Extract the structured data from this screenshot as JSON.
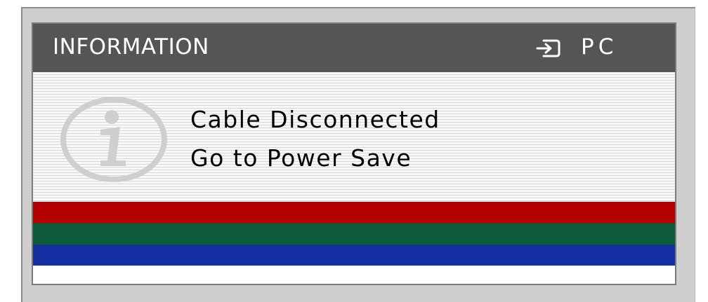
{
  "osd": {
    "title": "INFORMATION",
    "source_icon": "input-source-icon",
    "source_label": "PC",
    "info_icon": "info-icon",
    "messages": [
      "Cable Disconnected",
      "Go to Power Save"
    ],
    "color_bars": [
      {
        "name": "red",
        "color": "#b40000"
      },
      {
        "name": "green",
        "color": "#0c5a3a"
      },
      {
        "name": "blue",
        "color": "#122ea0"
      }
    ],
    "colors": {
      "header_bg": "#555555",
      "header_text": "#ffffff",
      "frame": "#cfcfcf"
    }
  }
}
